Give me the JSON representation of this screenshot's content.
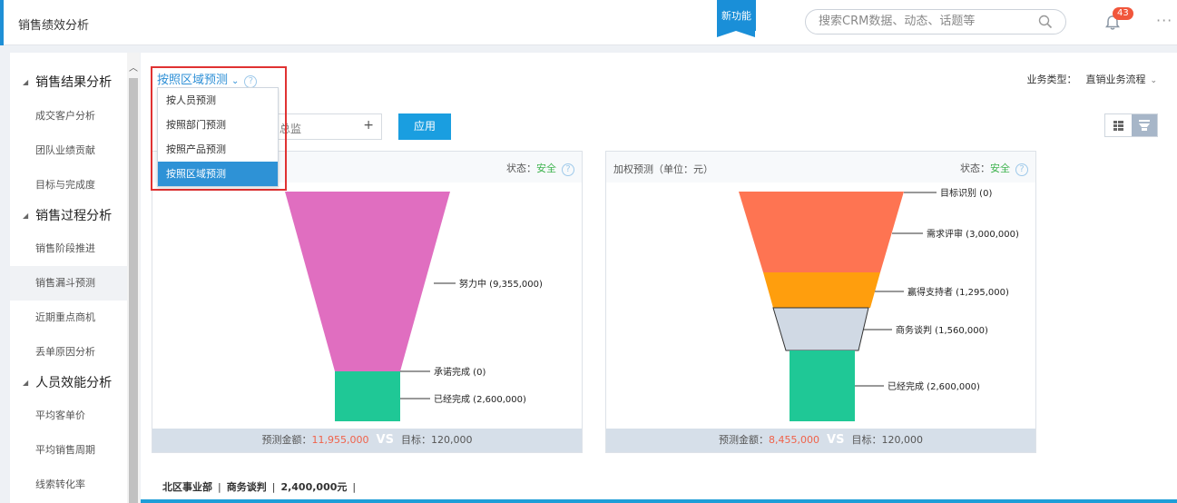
{
  "header": {
    "title": "销售绩效分析",
    "new_feature": "新功能",
    "search_placeholder": "搜索CRM数据、动态、话题等",
    "notification_count": "43",
    "more": "···"
  },
  "sidebar": {
    "groups": [
      {
        "label": "销售结果分析",
        "items": [
          "成交客户分析",
          "团队业绩贡献",
          "目标与完成度"
        ]
      },
      {
        "label": "销售过程分析",
        "items": [
          "销售阶段推进",
          "销售漏斗预测",
          "近期重点商机",
          "丢单原因分析"
        ]
      },
      {
        "label": "人员效能分析",
        "items": [
          "平均客单价",
          "平均销售周期",
          "线索转化率"
        ]
      }
    ],
    "active_item": "销售漏斗预测"
  },
  "toolbar": {
    "forecast_selected": "按照区域预测",
    "forecast_options": [
      "按人员预测",
      "按照部门预测",
      "按照产品预测",
      "按照区域预测"
    ],
    "biz_type_label": "业务类型：",
    "biz_type_value": "直销业务流程",
    "picker_text": "总监",
    "apply_label": "应用"
  },
  "cards": [
    {
      "title": "",
      "status_label": "状态：",
      "status_value": "安全",
      "forecast_label": "预测金额：",
      "forecast_value": "11,955,000",
      "vs": "VS",
      "target_label": "目标：",
      "target_value": "120,000"
    },
    {
      "title": "加权预测（单位：元）",
      "status_label": "状态：",
      "status_value": "安全",
      "forecast_label": "预测金额：",
      "forecast_value": "8,455,000",
      "vs": "VS",
      "target_label": "目标：",
      "target_value": "120,000"
    }
  ],
  "chart_data": [
    {
      "type": "funnel",
      "stages": [
        {
          "name": "努力中",
          "label": "努力中 (9,355,000)",
          "value": 9355000,
          "color": "#e06ec0"
        },
        {
          "name": "承诺完成",
          "label": "承诺完成 (0)",
          "value": 0,
          "color": "#e06ec0"
        },
        {
          "name": "已经完成",
          "label": "已经完成 (2,600,000)",
          "value": 2600000,
          "color": "#1fc896"
        }
      ]
    },
    {
      "type": "funnel",
      "stages": [
        {
          "name": "目标识别",
          "label": "目标识别 (0)",
          "value": 0,
          "color": "#fe7452"
        },
        {
          "name": "需求评审",
          "label": "需求评审 (3,000,000)",
          "value": 3000000,
          "color": "#fe7452"
        },
        {
          "name": "赢得支持者",
          "label": "赢得支持者 (1,295,000)",
          "value": 1295000,
          "color": "#ff9e0d"
        },
        {
          "name": "商务谈判",
          "label": "商务谈判 (1,560,000)",
          "value": 1560000,
          "color": "#d0d9e4"
        },
        {
          "name": "已经完成",
          "label": "已经完成 (2,600,000)",
          "value": 2600000,
          "color": "#1fc896"
        }
      ]
    }
  ],
  "bottom_summary": {
    "region": "北区事业部",
    "stage": "商务谈判",
    "amount": "2,400,000元"
  }
}
